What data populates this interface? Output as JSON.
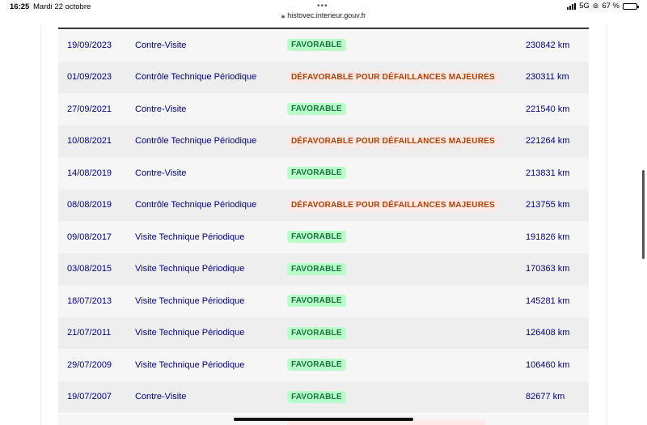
{
  "status_bar": {
    "time": "16:25",
    "date": "Mardi 22 octobre",
    "network": "5G",
    "battery": "67 %",
    "battery_level_percent": 67
  },
  "browser": {
    "url": "histovec.interieur.gouv.fr"
  },
  "inspections": [
    {
      "date": "19/09/2023",
      "type": "Contre-Visite",
      "result": "FAVORABLE",
      "status": "favorable",
      "mileage": "230842 km"
    },
    {
      "date": "01/09/2023",
      "type": "Contrôle Technique Périodique",
      "result": "DÉFAVORABLE POUR DÉFAILLANCES MAJEURES",
      "status": "defavorable",
      "mileage": "230311 km"
    },
    {
      "date": "27/09/2021",
      "type": "Contre-Visite",
      "result": "FAVORABLE",
      "status": "favorable",
      "mileage": "221540 km"
    },
    {
      "date": "10/08/2021",
      "type": "Contrôle Technique Périodique",
      "result": "DÉFAVORABLE POUR DÉFAILLANCES MAJEURES",
      "status": "defavorable",
      "mileage": "221264 km"
    },
    {
      "date": "14/08/2019",
      "type": "Contre-Visite",
      "result": "FAVORABLE",
      "status": "favorable",
      "mileage": "213831 km"
    },
    {
      "date": "08/08/2019",
      "type": "Contrôle Technique Périodique",
      "result": "DÉFAVORABLE POUR DÉFAILLANCES MAJEURES",
      "status": "defavorable",
      "mileage": "213755 km"
    },
    {
      "date": "09/08/2017",
      "type": "Visite Technique Périodique",
      "result": "FAVORABLE",
      "status": "favorable",
      "mileage": "191826 km"
    },
    {
      "date": "03/08/2015",
      "type": "Visite Technique Périodique",
      "result": "FAVORABLE",
      "status": "favorable",
      "mileage": "170363 km"
    },
    {
      "date": "18/07/2013",
      "type": "Visite Technique Périodique",
      "result": "FAVORABLE",
      "status": "favorable",
      "mileage": "145281 km"
    },
    {
      "date": "21/07/2011",
      "type": "Visite Technique Périodique",
      "result": "FAVORABLE",
      "status": "favorable",
      "mileage": "126408 km"
    },
    {
      "date": "29/07/2009",
      "type": "Visite Technique Périodique",
      "result": "FAVORABLE",
      "status": "favorable",
      "mileage": "106460 km"
    },
    {
      "date": "19/07/2007",
      "type": "Contre-Visite",
      "result": "FAVORABLE",
      "status": "favorable",
      "mileage": "82677 km"
    }
  ],
  "colors": {
    "text_blue": "#000091",
    "favorable_bg": "#b8fec9",
    "favorable_text": "#18753c",
    "defavorable_bg": "#ffe9e6",
    "defavorable_text": "#b34000"
  }
}
